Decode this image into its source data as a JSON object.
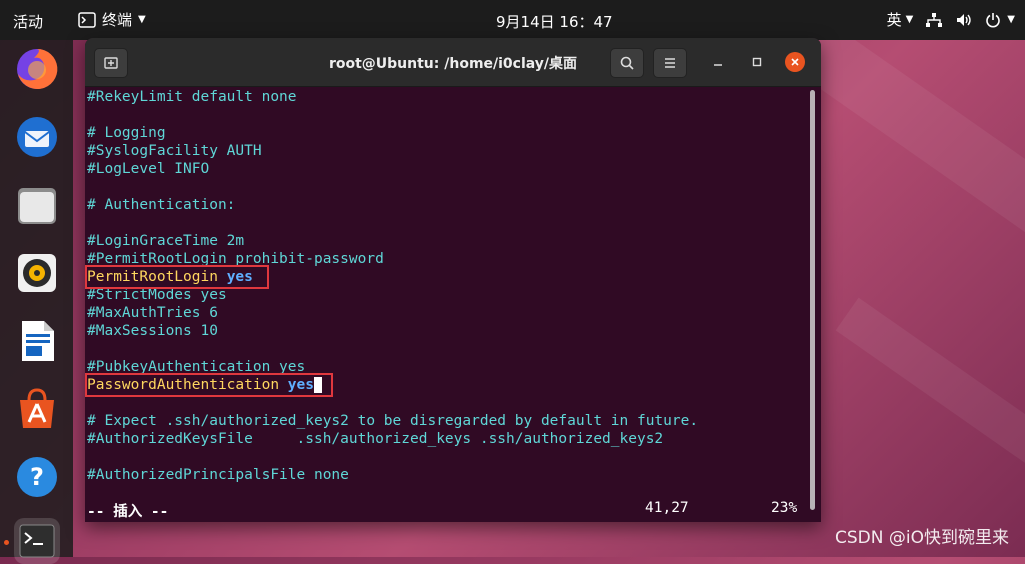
{
  "topbar": {
    "activities": "活动",
    "app_name": "终端",
    "clock": "9月14日  16：47",
    "input_method": "英"
  },
  "dock": {
    "items": [
      "firefox-icon",
      "thunderbird-icon",
      "files-icon",
      "rhythmbox-icon",
      "libreoffice-writer-icon",
      "software-center-icon",
      "help-icon",
      "terminal-icon"
    ]
  },
  "window": {
    "title": "root@Ubuntu: /home/i0clay/桌面"
  },
  "terminal": {
    "lines": [
      "#RekeyLimit default none",
      "",
      "# Logging",
      "#SyslogFacility AUTH",
      "#LogLevel INFO",
      "",
      "# Authentication:",
      "",
      "#LoginGraceTime 2m",
      "#PermitRootLogin prohibit-password",
      "PermitRootLogin",
      "#StrictModes yes",
      "#MaxAuthTries 6",
      "#MaxSessions 10",
      "",
      "#PubkeyAuthentication yes",
      "PasswordAuthentication",
      "",
      "# Expect .ssh/authorized_keys2 to be disregarded by default in future.",
      "#AuthorizedKeysFile     .ssh/authorized_keys .ssh/authorized_keys2",
      "",
      "#AuthorizedPrincipalsFile none"
    ],
    "yes_value": "yes",
    "mode": "-- 插入 --",
    "position": "41,27",
    "percent": "23%"
  },
  "watermark": "CSDN @iO快到碗里来",
  "colors": {
    "terminal_bg": "#300a24",
    "comment_text": "#5fd7d7",
    "active_text": "#ffd75f",
    "keyword_text": "#5fafff",
    "highlight_box": "#e0383e",
    "close_button": "#e95420"
  }
}
